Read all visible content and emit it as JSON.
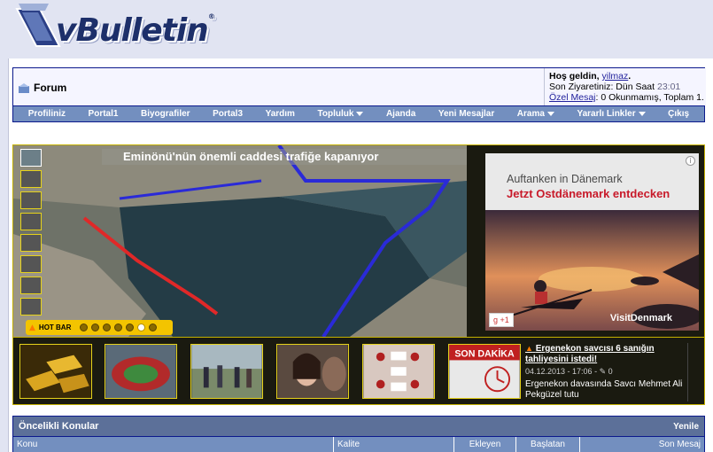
{
  "logo": {
    "text": "vBulletin",
    "tm": "®"
  },
  "breadcrumb": {
    "label": "Forum"
  },
  "user": {
    "welcome_prefix": "Hoş geldin,",
    "username": "yilmaz",
    "welcome_suffix": ".",
    "last_visit_label": "Son Ziyaretiniz: Dün Saat",
    "last_visit_time": "23:01",
    "pm_link": "Özel Mesaj",
    "pm_status": ": 0 Okunmamış, Toplam 1."
  },
  "nav": [
    {
      "label": "Profiliniz",
      "dropdown": false
    },
    {
      "label": "Portal1",
      "dropdown": false
    },
    {
      "label": "Biyografiler",
      "dropdown": false
    },
    {
      "label": "Portal3",
      "dropdown": false
    },
    {
      "label": "Yardım",
      "dropdown": false
    },
    {
      "label": "Topluluk",
      "dropdown": true
    },
    {
      "label": "Ajanda",
      "dropdown": false
    },
    {
      "label": "Yeni Mesajlar",
      "dropdown": false
    },
    {
      "label": "Arama",
      "dropdown": true
    },
    {
      "label": "Yararlı Linkler",
      "dropdown": true
    },
    {
      "label": "Çıkış",
      "dropdown": false
    }
  ],
  "slider": {
    "headline": "Eminönü'nün önemli caddesi trafiğe kapanıyor",
    "hotbar_label": "HOT BAR"
  },
  "ad": {
    "line1": "Auftanken in Dänemark",
    "line2": "Jetzt Ostdänemark entdecken",
    "gplus": "g +1",
    "brand": "VisitDenmark",
    "info": "i"
  },
  "featured_news": {
    "title": "Ergenekon savcısı 6 sanığın tahliyesini istedi!",
    "date": "04.12.2013 - 17:06 -",
    "comments": "0",
    "body": "Ergenekon davasında Savcı Mehmet Ali Pekgüzel tutu"
  },
  "strip_badge": "SON DAKİKA",
  "threads": {
    "title": "Öncelikli Konular",
    "link": "Yenile",
    "columns": [
      "Konu",
      "Kalite",
      "Ekleyen",
      "Başlatan",
      "Son Mesaj"
    ]
  },
  "colors": {
    "brand_blue": "#0b198c",
    "nav_bg": "#738fbf",
    "hotbar": "#f3c400",
    "ad_red": "#c81a2a"
  }
}
